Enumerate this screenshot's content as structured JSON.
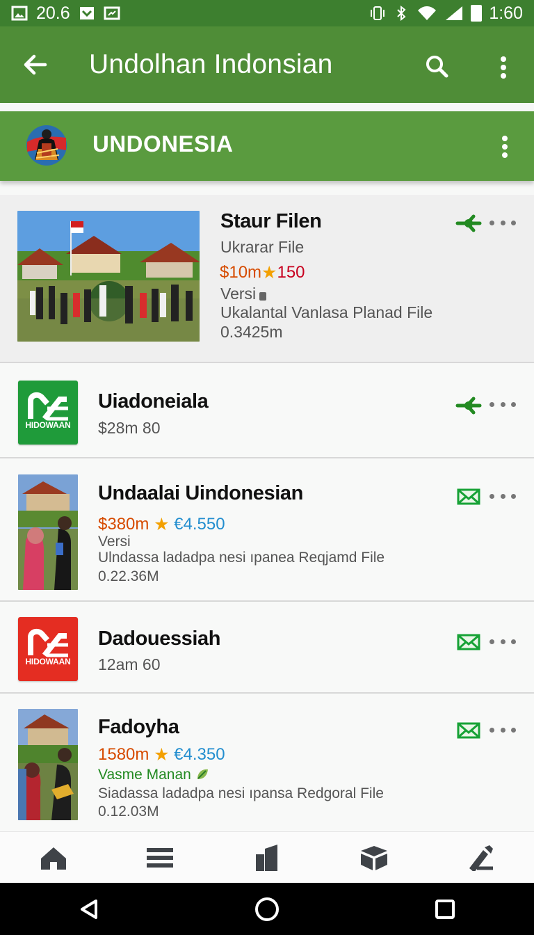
{
  "status_bar": {
    "left_value": "20.6",
    "time": "1:60",
    "icons": [
      "image-icon",
      "download-icon",
      "cast-icon",
      "vibrate-icon",
      "bluetooth-icon",
      "wifi-icon",
      "signal-icon",
      "battery-icon"
    ]
  },
  "app_bar": {
    "title": "Undolhan Indonsian",
    "icons": [
      "back-arrow-icon",
      "search-icon",
      "more-vertical-icon"
    ]
  },
  "banner": {
    "title": "UNDONESIA",
    "icons": [
      "dancer-avatar-icon",
      "more-vertical-icon"
    ]
  },
  "items": [
    {
      "title": "Staur Filen",
      "subtitle": "Ukrarar File",
      "price": "$10m",
      "rating": "150",
      "version": "Versi",
      "description": "Ukalantal Vanlasa Planad File",
      "size": "0.3425m",
      "action_icon": "share-icon"
    },
    {
      "title": "Uiadoneiala",
      "subtitle": "$28m 80",
      "logo_text": "HIDOWAAN",
      "action_icon": "share-icon"
    },
    {
      "title": "Undaalai Uindonesian",
      "price": "$380m",
      "rating": "€4.550",
      "version": "Versi",
      "description": "Ulndassa ladadpa nesi ıpanea Reqjamd File",
      "size": "0.22.36M",
      "action_icon": "mail-icon"
    },
    {
      "title": "Dadouessiah",
      "subtitle": "12am 60",
      "logo_text": "HIDOWAAN",
      "action_icon": "mail-icon"
    },
    {
      "title": "Fadoyha",
      "price": "1580m",
      "rating": "€4.350",
      "tag": "Vasme Manan",
      "description": "Siadassa ladadpa nesi ıpansa Redgoral File",
      "size": "0.12.03M",
      "action_icon": "mail-icon"
    }
  ],
  "bottom_nav": [
    "home-icon",
    "list-icon",
    "buildings-icon",
    "box-icon",
    "pen-icon"
  ],
  "system_nav": [
    "back-triangle-icon",
    "home-circle-icon",
    "recent-square-icon"
  ],
  "colors": {
    "appbar_green": "#4f8d37",
    "banner_green": "#5a9b3f",
    "accent_orange": "#d64b00",
    "rating_blue": "#238ecf",
    "share_green": "#238a22"
  }
}
